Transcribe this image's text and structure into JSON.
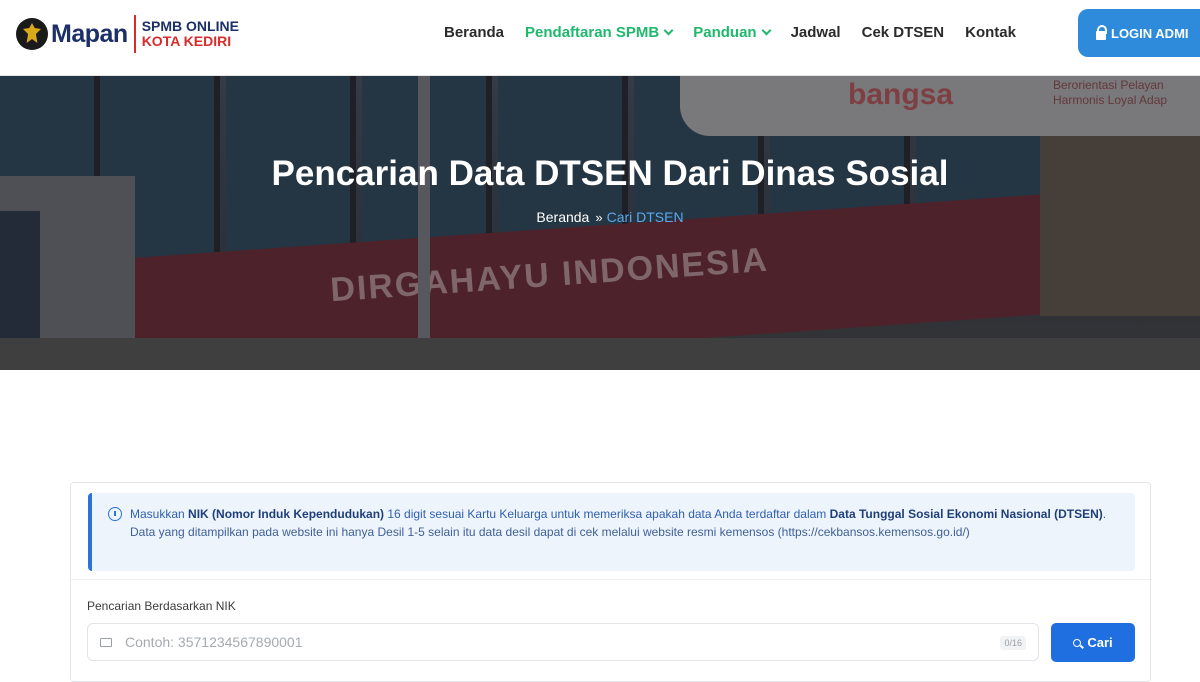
{
  "header": {
    "logo_word": "Mapan",
    "logo_line1": "SPMB ONLINE",
    "logo_line2": "KOTA KEDIRI",
    "nav": [
      {
        "label": "Beranda",
        "active": false
      },
      {
        "label": "Pendaftaran SPMB",
        "active": true,
        "dropdown": true
      },
      {
        "label": "Panduan",
        "active": true,
        "dropdown": true
      },
      {
        "label": "Jadwal",
        "active": false
      },
      {
        "label": "Cek DTSEN",
        "active": false
      },
      {
        "label": "Kontak",
        "active": false
      }
    ],
    "login_label": "LOGIN ADMI"
  },
  "hero": {
    "title": "Pencarian Data DTSEN Dari Dinas Sosial",
    "background_texts": {
      "banner": "DIRGAHAYU INDONESIA",
      "sign": "bangsa",
      "motto_line1": "Berorientasi Pelayan",
      "motto_line2": "Harmonis Loyal Adap"
    },
    "breadcrumb": {
      "home": "Beranda",
      "separator": "»",
      "current": "Cari DTSEN"
    }
  },
  "info": {
    "text_1": "Masukkan ",
    "bold_1": "NIK (Nomor Induk Kependudukan)",
    "text_2": " 16 digit sesuai Kartu Keluarga untuk memeriksa apakah data Anda terdaftar dalam ",
    "bold_2": "Data Tunggal Sosial Ekonomi Nasional (DTSEN)",
    "text_3": ".",
    "line_2": "Data yang ditampilkan pada website ini hanya Desil 1-5 selain itu data desil dapat di cek melalui website resmi kemensos (https://cekbansos.kemensos.go.id/)"
  },
  "search": {
    "label": "Pencarian Berdasarkan NIK",
    "placeholder": "Contoh: 3571234567890001",
    "counter": "0/16",
    "button_label": "Cari"
  },
  "colors": {
    "accent_green": "#1fb86c",
    "login_blue": "#2e8bdc",
    "button_blue": "#1f6fe0",
    "breadcrumb_current": "#5aa9ee"
  },
  "icons": [
    "garuda-emblem-icon",
    "chevron-down-icon",
    "lock-icon",
    "info-circle-icon",
    "id-card-icon",
    "search-icon"
  ]
}
